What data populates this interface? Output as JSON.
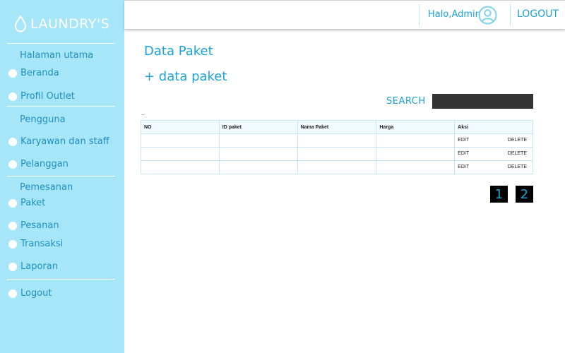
{
  "brand": {
    "name": "LAUNDRY'S"
  },
  "sidebar": {
    "sections": [
      {
        "header": "Halaman utama",
        "items": [
          "Beranda",
          "Profil Outlet"
        ]
      },
      {
        "header": "Pengguna",
        "items": [
          "Karyawan dan staff",
          "Pelanggan"
        ]
      },
      {
        "header": "Pemesanan",
        "items": [
          "Paket",
          "Pesanan",
          "Transaksi",
          "Laporan"
        ]
      }
    ],
    "logout": "Logout"
  },
  "topbar": {
    "greeting": "Halo,Admin",
    "logout": "LOGOUT"
  },
  "main": {
    "title": "Data Paket",
    "add_label": "+ data paket",
    "search_label": "SEARCH",
    "search_value": "",
    "dots": "..",
    "table": {
      "columns": [
        "NO",
        "ID paket",
        "Nama Paket",
        "Harga",
        "Aksi"
      ],
      "rows": [
        {
          "no": "",
          "id": "",
          "nama": "",
          "harga": "",
          "edit": "EDIT",
          "delete": "DELETE"
        },
        {
          "no": "",
          "id": "",
          "nama": "",
          "harga": "",
          "edit": "EDIT",
          "delete": "DELETE"
        },
        {
          "no": "",
          "id": "",
          "nama": "",
          "harga": "",
          "edit": "EDIT",
          "delete": "DELETE"
        }
      ]
    },
    "pagination": [
      "1",
      "2"
    ]
  },
  "colors": {
    "sidebar_bg": "#a6e6f8",
    "accent": "#1aa3d8",
    "search_bg": "#333333",
    "page_button_bg": "#000000"
  }
}
